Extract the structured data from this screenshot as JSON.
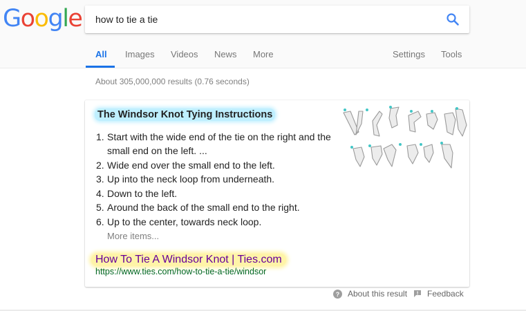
{
  "logo": {
    "letters": [
      "G",
      "o",
      "o",
      "g",
      "l",
      "e"
    ],
    "colors": [
      "#4285f4",
      "#ea4335",
      "#fbbc05",
      "#4285f4",
      "#34a853",
      "#ea4335"
    ]
  },
  "search": {
    "value": "how to tie a tie",
    "icon": "search-icon"
  },
  "tabs": [
    {
      "label": "All",
      "active": true
    },
    {
      "label": "Images"
    },
    {
      "label": "Videos"
    },
    {
      "label": "News"
    },
    {
      "label": "More"
    }
  ],
  "tools": {
    "settings": "Settings",
    "tools": "Tools"
  },
  "result_stats": "About 305,000,000 results (0.76 seconds)",
  "snippet": {
    "title": "The Windsor Knot Tying Instructions",
    "steps": [
      {
        "num": "1.",
        "text": "Start with the wide end of the tie on the right and the small end on the left. ..."
      },
      {
        "num": "2.",
        "text": "Wide end over the small end to the left."
      },
      {
        "num": "3.",
        "text": "Up into the neck loop from underneath."
      },
      {
        "num": "4.",
        "text": "Down to the left."
      },
      {
        "num": "5.",
        "text": "Around the back of the small end to the right."
      },
      {
        "num": "6.",
        "text": "Up to the center, towards neck loop."
      }
    ],
    "more_items": "More items...",
    "result_title": "How To Tie A Windsor Knot | Ties.com",
    "result_url": "https://www.ties.com/how-to-tie-a-tie/windsor",
    "thumbnail_icon": "tie-knot-diagram-icon"
  },
  "footer": {
    "about": "About this result",
    "feedback": "Feedback"
  },
  "colors": {
    "accent_blue": "#1a73e8",
    "title_highlight": "#bfefff",
    "link_highlight": "#fff4a8",
    "url_green": "#006621",
    "visited_purple": "#660099"
  }
}
